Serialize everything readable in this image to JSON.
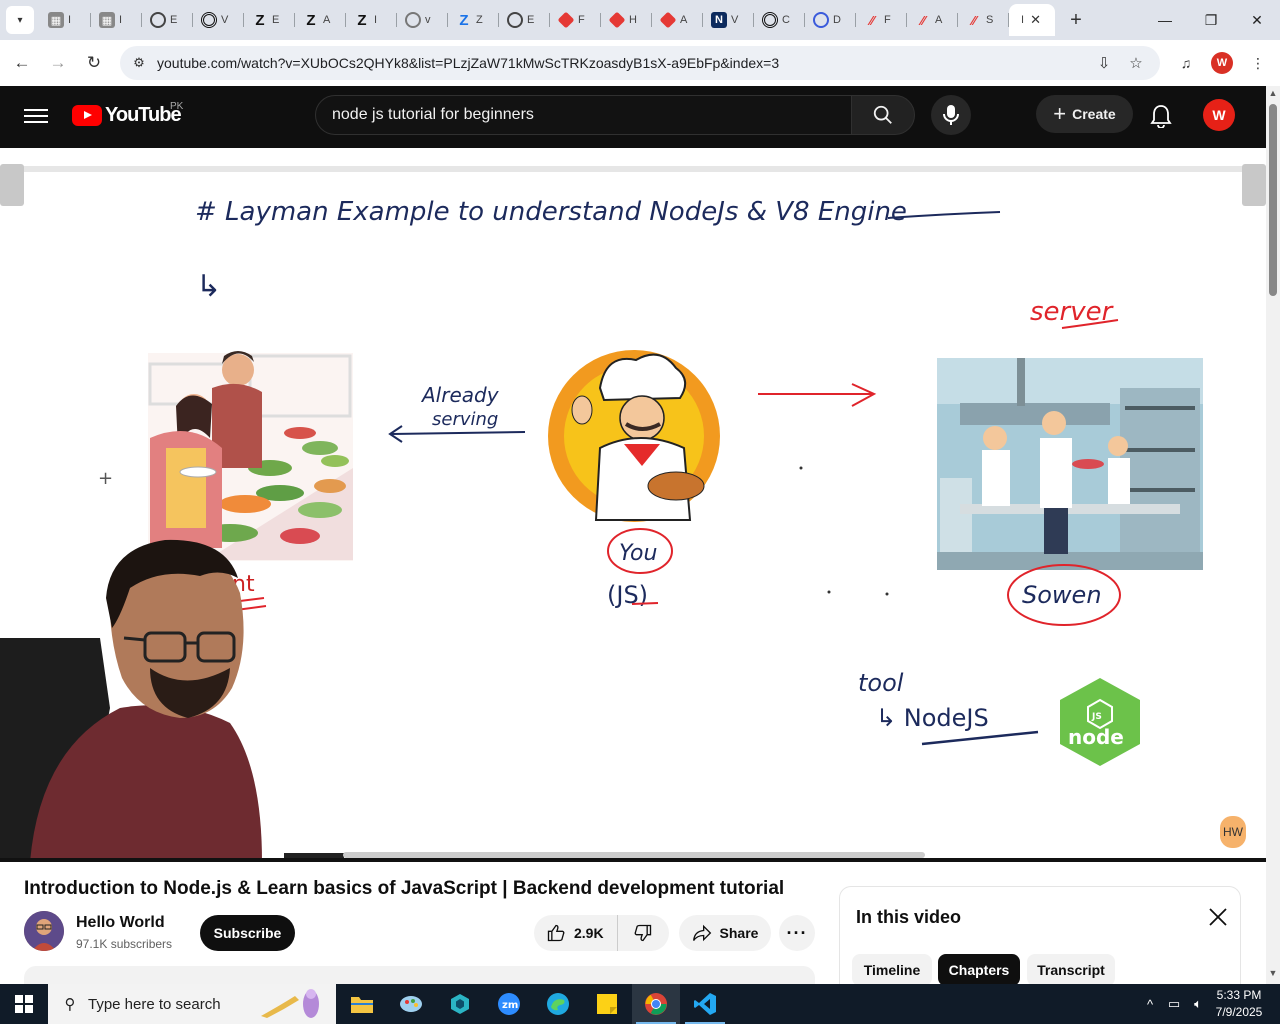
{
  "browser": {
    "tabs": [
      {
        "label": "I",
        "icon": "page-icon",
        "color": "#6f6f6f"
      },
      {
        "label": "I",
        "icon": "page-icon",
        "color": "#6f6f6f"
      },
      {
        "label": "E",
        "icon": "globe-icon",
        "color": "#333333"
      },
      {
        "label": "V",
        "icon": "openai-icon",
        "color": "#111111"
      },
      {
        "label": "E",
        "icon": "z-icon",
        "color": "#111111"
      },
      {
        "label": "A",
        "icon": "z-icon",
        "color": "#111111"
      },
      {
        "label": "I",
        "icon": "z-icon",
        "color": "#111111"
      },
      {
        "label": "v",
        "icon": "globe-icon",
        "color": "#333333"
      },
      {
        "label": "Z",
        "icon": "z-icon",
        "color": "#1a73e8"
      },
      {
        "label": "E",
        "icon": "globe-icon",
        "color": "#333333"
      },
      {
        "label": "F",
        "icon": "diamond-icon",
        "color": "#e53935"
      },
      {
        "label": "H",
        "icon": "diamond-icon",
        "color": "#e53935"
      },
      {
        "label": "A",
        "icon": "diamond-icon",
        "color": "#e53935"
      },
      {
        "label": "V",
        "icon": "n-icon",
        "color": "#0d2b5e"
      },
      {
        "label": "C",
        "icon": "openai-icon",
        "color": "#111111"
      },
      {
        "label": "D",
        "icon": "copilot-icon",
        "color": "#3b5bdb"
      },
      {
        "label": "F",
        "icon": "slash-icon",
        "color": "#e53935"
      },
      {
        "label": "A",
        "icon": "slash-icon",
        "color": "#e53935"
      },
      {
        "label": "S",
        "icon": "slash-icon",
        "color": "#e53935"
      }
    ],
    "active_tab": {
      "label": "I",
      "icon": "youtube-icon"
    },
    "url": "youtube.com/watch?v=XUbOCs2QHYk8&list=PLzjZaW71kMwScTRKzoasdyB1sX-a9EbFp&index=3",
    "profile_initial": "W"
  },
  "youtube": {
    "logo_text": "YouTube",
    "country_code": "PK",
    "search_query": "node js tutorial for beginners",
    "create_label": "Create",
    "avatar_initial": "W"
  },
  "whiteboard": {
    "heading": "# Layman Example to understand NodeJs & V8 Engine",
    "arrow_mark": "↳",
    "already_serving": [
      "Already",
      "serving"
    ],
    "client_label": "nt",
    "you_label": "You",
    "js_label": "(JS)",
    "server_top_label": "server",
    "server_bottom_label": "Sowen",
    "tool_label": "tool",
    "nodejs_label": "↳ NodeJS",
    "node_logo_text": "node",
    "node_logo_badge": "JS",
    "badge": "HW"
  },
  "video": {
    "title": "Introduction to Node.js & Learn basics of JavaScript | Backend development tutorial",
    "channel_name": "Hello World",
    "subscribers": "97.1K subscribers",
    "subscribe_label": "Subscribe",
    "likes": "2.9K",
    "share_label": "Share"
  },
  "panel": {
    "title": "In this video",
    "chips": [
      {
        "label": "Timeline",
        "active": false
      },
      {
        "label": "Chapters",
        "active": true
      },
      {
        "label": "Transcript",
        "active": false
      }
    ]
  },
  "taskbar": {
    "search_placeholder": "Type here to search",
    "time": "5:33 PM",
    "date": "7/9/2025"
  },
  "colors": {
    "youtube_red": "#ff0000",
    "masthead_bg": "#0f0f0f",
    "marker_red": "#e0242b",
    "marker_blue": "#1c2a5c",
    "taskbar_bg": "#101b28"
  }
}
